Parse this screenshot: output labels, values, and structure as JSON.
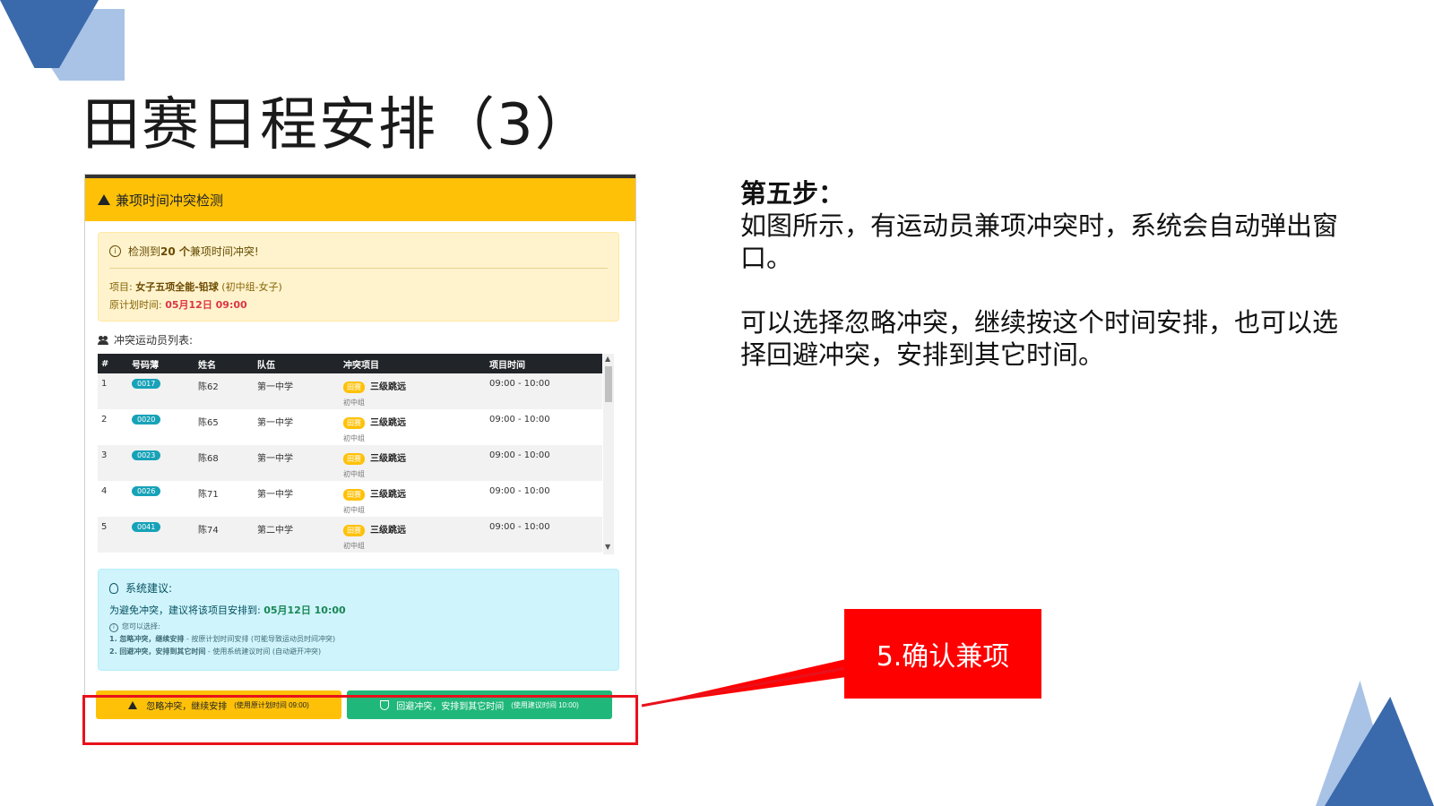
{
  "slide": {
    "title": "田赛日程安排（3）",
    "step_heading": "第五步：",
    "step_text1": "如图所示，有运动员兼项冲突时，系统会自动弹出窗口。",
    "step_text2": "可以选择忽略冲突，继续按这个时间安排，也可以选择回避冲突，安排到其它时间。",
    "callout": "5.确认兼项",
    "colors": {
      "accent_blue": "#3a6aac",
      "light_blue": "#a9c3e6",
      "callout_red": "#ff0000"
    }
  },
  "modal": {
    "title": "兼项时间冲突检测",
    "alert": {
      "prefix": "检测到 ",
      "count": "20 个",
      "suffix": "兼项时间冲突!",
      "item_label": "项目: ",
      "item_name": "女子五项全能-铅球",
      "item_group": "(初中组-女子)",
      "time_label": "原计划时间: ",
      "time_value": "05月12日 09:00"
    },
    "list_label": "冲突运动员列表:",
    "columns": [
      "#",
      "号码薄",
      "姓名",
      "队伍",
      "冲突项目",
      "项目时间"
    ],
    "rows": [
      {
        "no": "1",
        "bib": "0017",
        "name": "陈62",
        "team": "第一中学",
        "tag": "田赛",
        "event": "三级跳远",
        "group": "初中组",
        "time": "09:00 - 10:00"
      },
      {
        "no": "2",
        "bib": "0020",
        "name": "陈65",
        "team": "第一中学",
        "tag": "田赛",
        "event": "三级跳远",
        "group": "初中组",
        "time": "09:00 - 10:00"
      },
      {
        "no": "3",
        "bib": "0023",
        "name": "陈68",
        "team": "第一中学",
        "tag": "田赛",
        "event": "三级跳远",
        "group": "初中组",
        "time": "09:00 - 10:00"
      },
      {
        "no": "4",
        "bib": "0026",
        "name": "陈71",
        "team": "第一中学",
        "tag": "田赛",
        "event": "三级跳远",
        "group": "初中组",
        "time": "09:00 - 10:00"
      },
      {
        "no": "5",
        "bib": "0041",
        "name": "陈74",
        "team": "第二中学",
        "tag": "田赛",
        "event": "三级跳远",
        "group": "初中组",
        "time": "09:00 - 10:00"
      }
    ],
    "suggest": {
      "heading": "系统建议:",
      "text": "为避免冲突，建议将该项目安排到: ",
      "time": "05月12日 10:00",
      "options_head": "您可以选择:",
      "opt1_bold": "1. 忽略冲突，继续安排",
      "opt1_rest": " - 按原计划时间安排 (可能导致运动员时间冲突)",
      "opt2_bold": "2. 回避冲突，安排到其它时间",
      "opt2_rest": " - 使用系统建议时间 (自动避开冲突)"
    },
    "btn_ignore": "忽略冲突，继续安排",
    "btn_ignore_note": "(使用原计划时间 09:00)",
    "btn_avoid": "回避冲突，安排到其它时间",
    "btn_avoid_note": "(使用建议时间 10:00)"
  }
}
